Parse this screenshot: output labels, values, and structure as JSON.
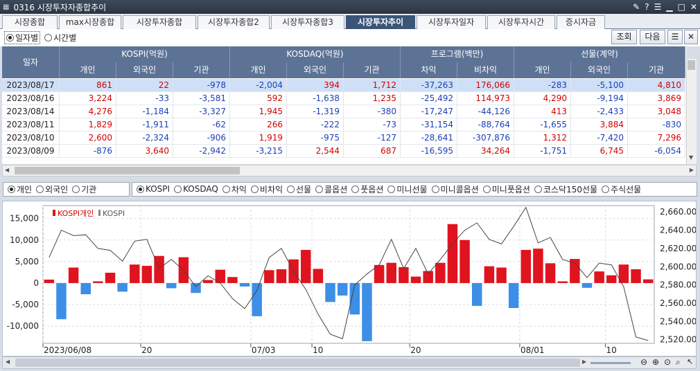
{
  "window": {
    "title": "0316 시장투자자종합추이"
  },
  "tabs": [
    "시장종합",
    "max시장종합",
    "시장투자종합",
    "시장투자종합2",
    "시장투자종합3",
    "시장투자추이",
    "시장투자일자",
    "시장투자시간",
    "증시자금"
  ],
  "active_tab": "시장투자추이",
  "period_options": {
    "daily": "일자별",
    "hourly": "시간별",
    "selected": "일자별"
  },
  "buttons": {
    "query": "조회",
    "next": "다음"
  },
  "table": {
    "date_header": "일자",
    "groups": [
      "KOSPI(억원)",
      "KOSDAQ(억원)",
      "프로그램(백만)",
      "선물(계약)"
    ],
    "subheaders": [
      "개인",
      "외국인",
      "기관",
      "개인",
      "외국인",
      "기관",
      "차익",
      "비차익",
      "개인",
      "외국인",
      "기관"
    ],
    "rows": [
      [
        "2023/08/17",
        "861",
        "22",
        "-978",
        "-2,004",
        "394",
        "1,712",
        "-37,263",
        "176,066",
        "-283",
        "-5,100",
        "4,810"
      ],
      [
        "2023/08/16",
        "3,224",
        "-33",
        "-3,581",
        "592",
        "-1,638",
        "1,235",
        "-25,492",
        "114,973",
        "4,290",
        "-9,194",
        "3,869"
      ],
      [
        "2023/08/14",
        "4,276",
        "-1,184",
        "-3,327",
        "1,945",
        "-1,319",
        "-380",
        "-17,247",
        "-44,126",
        "413",
        "-2,433",
        "3,048"
      ],
      [
        "2023/08/11",
        "1,829",
        "-1,911",
        "-62",
        "266",
        "-222",
        "-73",
        "-31,154",
        "-88,764",
        "-1,655",
        "3,884",
        "-830"
      ],
      [
        "2023/08/10",
        "2,600",
        "-2,324",
        "-906",
        "1,919",
        "-975",
        "-127",
        "-28,641",
        "-307,876",
        "1,312",
        "-7,420",
        "7,296"
      ],
      [
        "2023/08/09",
        "-876",
        "3,640",
        "-2,942",
        "-3,215",
        "2,544",
        "687",
        "-16,595",
        "34,264",
        "-1,751",
        "6,745",
        "-6,054"
      ]
    ]
  },
  "investor_options": {
    "items": [
      "개인",
      "외국인",
      "기관"
    ],
    "selected": "개인"
  },
  "market_options": {
    "items": [
      "KOSPI",
      "KOSDAQ",
      "차익",
      "비차익",
      "선물",
      "콜옵션",
      "풋옵션",
      "미니선물",
      "미니콜옵션",
      "미니풋옵션",
      "코스닥150선물",
      "주식선물"
    ],
    "selected": "KOSPI"
  },
  "chart_data": {
    "type": "bar",
    "legend": [
      "KOSPI개인",
      "KOSPI"
    ],
    "left_ticks": [
      "15,000",
      "10,000",
      "5,000",
      "0",
      "-5,000",
      "-10,000"
    ],
    "right_ticks": [
      "2,660.00",
      "2,640.00",
      "2,620.00",
      "2,600.00",
      "2,580.00",
      "2,560.00",
      "2,540.00",
      "2,520.00"
    ],
    "x_labels": [
      "2023/06/08",
      "20",
      "07/03",
      "10",
      "20",
      "08/01",
      "10"
    ],
    "ylim_left": [
      -14000,
      18000
    ],
    "ylim_right": [
      2516,
      2667
    ],
    "series": [
      {
        "name": "KOSPI개인",
        "values": [
          800,
          -8400,
          3600,
          -2600,
          400,
          2400,
          -2000,
          4300,
          4000,
          6300,
          -1200,
          6000,
          -2300,
          700,
          3100,
          1400,
          -800,
          -7700,
          3000,
          3200,
          5500,
          7700,
          3300,
          -4400,
          -2900,
          -7300,
          -13500,
          4200,
          4700,
          3700,
          1500,
          2800,
          4700,
          13700,
          10000,
          -5300,
          3900,
          3600,
          -5800,
          7700,
          8000,
          4600,
          400,
          5600,
          -1100,
          2700,
          1800,
          4300,
          3200,
          861
        ]
      },
      {
        "name": "KOSPI",
        "values": [
          2610,
          2640,
          2634,
          2635,
          2620,
          2618,
          2606,
          2628,
          2630,
          2598,
          2608,
          2596,
          2578,
          2590,
          2582,
          2565,
          2554,
          2574,
          2610,
          2620,
          2595,
          2575,
          2548,
          2526,
          2521,
          2580,
          2592,
          2602,
          2630,
          2598,
          2620,
          2592,
          2608,
          2625,
          2640,
          2648,
          2630,
          2625,
          2644,
          2665,
          2626,
          2632,
          2608,
          2604,
          2588,
          2604,
          2602,
          2578,
          2523,
          2519
        ]
      }
    ]
  }
}
